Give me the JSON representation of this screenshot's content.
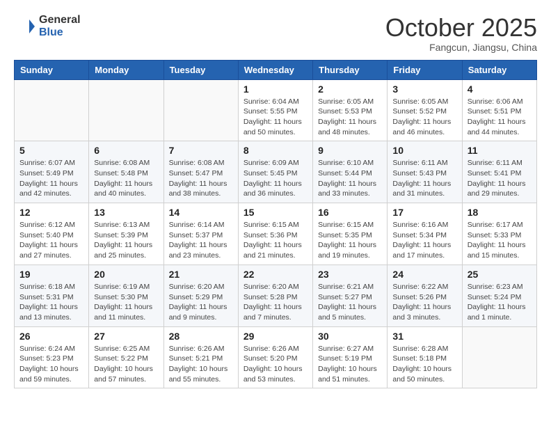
{
  "logo": {
    "line1": "General",
    "line2": "Blue"
  },
  "title": "October 2025",
  "subtitle": "Fangcun, Jiangsu, China",
  "days_of_week": [
    "Sunday",
    "Monday",
    "Tuesday",
    "Wednesday",
    "Thursday",
    "Friday",
    "Saturday"
  ],
  "weeks": [
    [
      {
        "day": "",
        "sunrise": "",
        "sunset": "",
        "daylight": ""
      },
      {
        "day": "",
        "sunrise": "",
        "sunset": "",
        "daylight": ""
      },
      {
        "day": "",
        "sunrise": "",
        "sunset": "",
        "daylight": ""
      },
      {
        "day": "1",
        "sunrise": "Sunrise: 6:04 AM",
        "sunset": "Sunset: 5:55 PM",
        "daylight": "Daylight: 11 hours and 50 minutes."
      },
      {
        "day": "2",
        "sunrise": "Sunrise: 6:05 AM",
        "sunset": "Sunset: 5:53 PM",
        "daylight": "Daylight: 11 hours and 48 minutes."
      },
      {
        "day": "3",
        "sunrise": "Sunrise: 6:05 AM",
        "sunset": "Sunset: 5:52 PM",
        "daylight": "Daylight: 11 hours and 46 minutes."
      },
      {
        "day": "4",
        "sunrise": "Sunrise: 6:06 AM",
        "sunset": "Sunset: 5:51 PM",
        "daylight": "Daylight: 11 hours and 44 minutes."
      }
    ],
    [
      {
        "day": "5",
        "sunrise": "Sunrise: 6:07 AM",
        "sunset": "Sunset: 5:49 PM",
        "daylight": "Daylight: 11 hours and 42 minutes."
      },
      {
        "day": "6",
        "sunrise": "Sunrise: 6:08 AM",
        "sunset": "Sunset: 5:48 PM",
        "daylight": "Daylight: 11 hours and 40 minutes."
      },
      {
        "day": "7",
        "sunrise": "Sunrise: 6:08 AM",
        "sunset": "Sunset: 5:47 PM",
        "daylight": "Daylight: 11 hours and 38 minutes."
      },
      {
        "day": "8",
        "sunrise": "Sunrise: 6:09 AM",
        "sunset": "Sunset: 5:45 PM",
        "daylight": "Daylight: 11 hours and 36 minutes."
      },
      {
        "day": "9",
        "sunrise": "Sunrise: 6:10 AM",
        "sunset": "Sunset: 5:44 PM",
        "daylight": "Daylight: 11 hours and 33 minutes."
      },
      {
        "day": "10",
        "sunrise": "Sunrise: 6:11 AM",
        "sunset": "Sunset: 5:43 PM",
        "daylight": "Daylight: 11 hours and 31 minutes."
      },
      {
        "day": "11",
        "sunrise": "Sunrise: 6:11 AM",
        "sunset": "Sunset: 5:41 PM",
        "daylight": "Daylight: 11 hours and 29 minutes."
      }
    ],
    [
      {
        "day": "12",
        "sunrise": "Sunrise: 6:12 AM",
        "sunset": "Sunset: 5:40 PM",
        "daylight": "Daylight: 11 hours and 27 minutes."
      },
      {
        "day": "13",
        "sunrise": "Sunrise: 6:13 AM",
        "sunset": "Sunset: 5:39 PM",
        "daylight": "Daylight: 11 hours and 25 minutes."
      },
      {
        "day": "14",
        "sunrise": "Sunrise: 6:14 AM",
        "sunset": "Sunset: 5:37 PM",
        "daylight": "Daylight: 11 hours and 23 minutes."
      },
      {
        "day": "15",
        "sunrise": "Sunrise: 6:15 AM",
        "sunset": "Sunset: 5:36 PM",
        "daylight": "Daylight: 11 hours and 21 minutes."
      },
      {
        "day": "16",
        "sunrise": "Sunrise: 6:15 AM",
        "sunset": "Sunset: 5:35 PM",
        "daylight": "Daylight: 11 hours and 19 minutes."
      },
      {
        "day": "17",
        "sunrise": "Sunrise: 6:16 AM",
        "sunset": "Sunset: 5:34 PM",
        "daylight": "Daylight: 11 hours and 17 minutes."
      },
      {
        "day": "18",
        "sunrise": "Sunrise: 6:17 AM",
        "sunset": "Sunset: 5:33 PM",
        "daylight": "Daylight: 11 hours and 15 minutes."
      }
    ],
    [
      {
        "day": "19",
        "sunrise": "Sunrise: 6:18 AM",
        "sunset": "Sunset: 5:31 PM",
        "daylight": "Daylight: 11 hours and 13 minutes."
      },
      {
        "day": "20",
        "sunrise": "Sunrise: 6:19 AM",
        "sunset": "Sunset: 5:30 PM",
        "daylight": "Daylight: 11 hours and 11 minutes."
      },
      {
        "day": "21",
        "sunrise": "Sunrise: 6:20 AM",
        "sunset": "Sunset: 5:29 PM",
        "daylight": "Daylight: 11 hours and 9 minutes."
      },
      {
        "day": "22",
        "sunrise": "Sunrise: 6:20 AM",
        "sunset": "Sunset: 5:28 PM",
        "daylight": "Daylight: 11 hours and 7 minutes."
      },
      {
        "day": "23",
        "sunrise": "Sunrise: 6:21 AM",
        "sunset": "Sunset: 5:27 PM",
        "daylight": "Daylight: 11 hours and 5 minutes."
      },
      {
        "day": "24",
        "sunrise": "Sunrise: 6:22 AM",
        "sunset": "Sunset: 5:26 PM",
        "daylight": "Daylight: 11 hours and 3 minutes."
      },
      {
        "day": "25",
        "sunrise": "Sunrise: 6:23 AM",
        "sunset": "Sunset: 5:24 PM",
        "daylight": "Daylight: 11 hours and 1 minute."
      }
    ],
    [
      {
        "day": "26",
        "sunrise": "Sunrise: 6:24 AM",
        "sunset": "Sunset: 5:23 PM",
        "daylight": "Daylight: 10 hours and 59 minutes."
      },
      {
        "day": "27",
        "sunrise": "Sunrise: 6:25 AM",
        "sunset": "Sunset: 5:22 PM",
        "daylight": "Daylight: 10 hours and 57 minutes."
      },
      {
        "day": "28",
        "sunrise": "Sunrise: 6:26 AM",
        "sunset": "Sunset: 5:21 PM",
        "daylight": "Daylight: 10 hours and 55 minutes."
      },
      {
        "day": "29",
        "sunrise": "Sunrise: 6:26 AM",
        "sunset": "Sunset: 5:20 PM",
        "daylight": "Daylight: 10 hours and 53 minutes."
      },
      {
        "day": "30",
        "sunrise": "Sunrise: 6:27 AM",
        "sunset": "Sunset: 5:19 PM",
        "daylight": "Daylight: 10 hours and 51 minutes."
      },
      {
        "day": "31",
        "sunrise": "Sunrise: 6:28 AM",
        "sunset": "Sunset: 5:18 PM",
        "daylight": "Daylight: 10 hours and 50 minutes."
      },
      {
        "day": "",
        "sunrise": "",
        "sunset": "",
        "daylight": ""
      }
    ]
  ]
}
